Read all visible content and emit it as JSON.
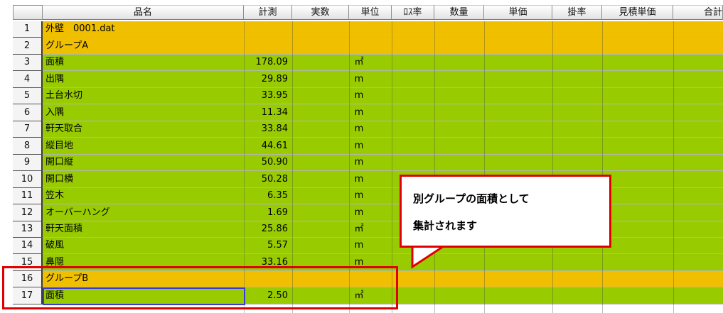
{
  "headers": [
    "品名",
    "計測",
    "実数",
    "単位",
    "ﾛｽ率",
    "数量",
    "単価",
    "掛率",
    "見積単価",
    "合計"
  ],
  "rows": [
    {
      "num": "1",
      "name": "外壁　0001.dat",
      "measure": "",
      "unit": "",
      "style": "yellow"
    },
    {
      "num": "2",
      "name": "グループA",
      "measure": "",
      "unit": "",
      "style": "yellow"
    },
    {
      "num": "3",
      "name": "面積",
      "measure": "178.09",
      "unit": "㎡",
      "style": "green"
    },
    {
      "num": "4",
      "name": "出隅",
      "measure": "29.89",
      "unit": "m",
      "style": "green"
    },
    {
      "num": "5",
      "name": "土台水切",
      "measure": "33.95",
      "unit": "m",
      "style": "green"
    },
    {
      "num": "6",
      "name": "入隅",
      "measure": "11.34",
      "unit": "m",
      "style": "green"
    },
    {
      "num": "7",
      "name": "軒天取合",
      "measure": "33.84",
      "unit": "m",
      "style": "green"
    },
    {
      "num": "8",
      "name": "縦目地",
      "measure": "44.61",
      "unit": "m",
      "style": "green"
    },
    {
      "num": "9",
      "name": "開口縦",
      "measure": "50.90",
      "unit": "m",
      "style": "green"
    },
    {
      "num": "10",
      "name": "開口横",
      "measure": "50.28",
      "unit": "m",
      "style": "green"
    },
    {
      "num": "11",
      "name": "笠木",
      "measure": "6.35",
      "unit": "m",
      "style": "green"
    },
    {
      "num": "12",
      "name": "オーバーハング",
      "measure": "1.69",
      "unit": "m",
      "style": "green"
    },
    {
      "num": "13",
      "name": "軒天面積",
      "measure": "25.86",
      "unit": "㎡",
      "style": "green"
    },
    {
      "num": "14",
      "name": "破風",
      "measure": "5.57",
      "unit": "m",
      "style": "green"
    },
    {
      "num": "15",
      "name": "鼻隠",
      "measure": "33.16",
      "unit": "m",
      "style": "green"
    },
    {
      "num": "16",
      "name": "グループB",
      "measure": "",
      "unit": "",
      "style": "yellow"
    },
    {
      "num": "17",
      "name": "面積",
      "measure": "2.50",
      "unit": "㎡",
      "style": "green"
    }
  ],
  "callout": {
    "line1": "別グループの面積として",
    "line2": "集計されます"
  },
  "colors": {
    "group_row": "#f0c000",
    "item_row": "#99cc00",
    "annotation": "#e00000",
    "selection": "#3a3ad8"
  }
}
